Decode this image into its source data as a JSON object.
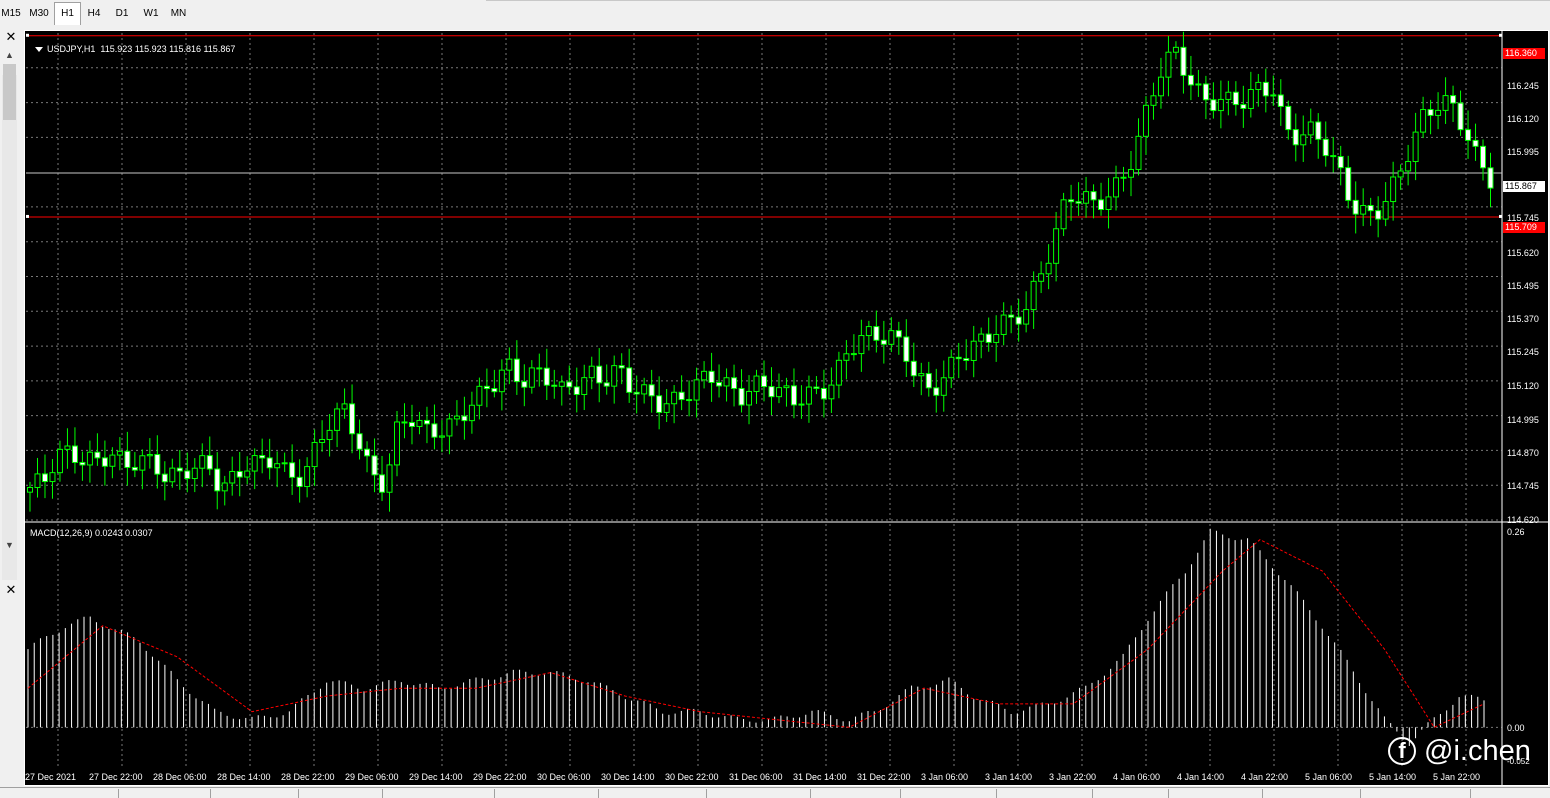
{
  "timeframes": [
    "M15",
    "M30",
    "H1",
    "H4",
    "D1",
    "W1",
    "MN"
  ],
  "active_timeframe": "H1",
  "chart": {
    "title": "USDJPY,H1  115.923 115.923 115.816 115.867",
    "macd_label": "MACD(12,26,9) 0.0243 0.0307",
    "price_ticks": [
      "116.245",
      "116.120",
      "115.995",
      "115.745",
      "115.620",
      "115.495",
      "115.370",
      "115.245",
      "115.120",
      "114.995",
      "114.870",
      "114.745",
      "114.620"
    ],
    "current_price": "115.867",
    "hline_top": "116.360",
    "hline_bottom": "115.709",
    "macd_ticks": [
      "0.26",
      "0.00",
      "-0.052"
    ],
    "time_labels": [
      "27 Dec 2021",
      "27 Dec 22:00",
      "28 Dec 06:00",
      "28 Dec 14:00",
      "28 Dec 22:00",
      "29 Dec 06:00",
      "29 Dec 14:00",
      "29 Dec 22:00",
      "30 Dec 06:00",
      "30 Dec 14:00",
      "30 Dec 22:00",
      "31 Dec 06:00",
      "31 Dec 14:00",
      "31 Dec 22:00",
      "3 Jan 06:00",
      "3 Jan 14:00",
      "3 Jan 22:00",
      "4 Jan 06:00",
      "4 Jan 14:00",
      "4 Jan 22:00",
      "5 Jan 06:00",
      "5 Jan 14:00",
      "5 Jan 22:00"
    ],
    "colors": {
      "background": "#000000",
      "bull": "#00ff00",
      "bear_body": "#ffffff",
      "grid": "#c8c8c8",
      "hline": "#ff0000",
      "signal": "#ff0000"
    }
  },
  "watermark": "@i.chen",
  "watermark_icon": "facebook-icon",
  "chart_data": [
    {
      "type": "candlestick",
      "symbol": "USDJPY",
      "timeframe": "H1",
      "ylim": [
        114.62,
        116.37
      ],
      "close_path": [
        114.72,
        114.74,
        114.86,
        114.88,
        114.85,
        114.82,
        114.84,
        114.8,
        114.86,
        114.84,
        114.78,
        114.76,
        114.8,
        114.82,
        114.76,
        114.78,
        114.82,
        114.8,
        114.84,
        114.78,
        114.8,
        114.88,
        114.96,
        115.0,
        114.92,
        114.8,
        114.76,
        114.95,
        114.97,
        114.93,
        114.96,
        114.98,
        115.02,
        115.05,
        115.1,
        115.18,
        115.14,
        115.16,
        115.12,
        115.06,
        115.1,
        115.16,
        115.14,
        115.16,
        115.08,
        115.06,
        115.05,
        115.06,
        115.08,
        115.1,
        115.12,
        115.1,
        115.08,
        115.12,
        115.1,
        115.06,
        115.04,
        115.08,
        115.1,
        115.14,
        115.22,
        115.26,
        115.28,
        115.3,
        115.26,
        115.12,
        115.06,
        115.12,
        115.22,
        115.26,
        115.28,
        115.3,
        115.32,
        115.38,
        115.52,
        115.64,
        115.78,
        115.76,
        115.74,
        115.8,
        115.86,
        115.96,
        116.1,
        116.24,
        116.3,
        116.22,
        116.14,
        116.12,
        116.1,
        116.12,
        116.18,
        116.2,
        116.02,
        115.98,
        116.0,
        115.96,
        115.88,
        115.76,
        115.7,
        115.72,
        115.82,
        115.96,
        116.08,
        116.12,
        116.1,
        116.02,
        115.92,
        115.867
      ]
    },
    {
      "type": "histogram+line",
      "name": "MACD(12,26,9)",
      "ylim": [
        -0.052,
        0.26
      ],
      "macd_points": [
        [
          0,
          0.1
        ],
        [
          6,
          0.13
        ],
        [
          10,
          0.14
        ],
        [
          18,
          0.11
        ],
        [
          24,
          0.06
        ],
        [
          30,
          0.02
        ],
        [
          36,
          0.01
        ],
        [
          42,
          0.02
        ],
        [
          48,
          0.06
        ],
        [
          54,
          0.05
        ],
        [
          60,
          0.06
        ],
        [
          66,
          0.05
        ],
        [
          72,
          0.06
        ],
        [
          78,
          0.07
        ],
        [
          84,
          0.07
        ],
        [
          90,
          0.06
        ],
        [
          96,
          0.04
        ],
        [
          102,
          0.02
        ],
        [
          108,
          0.02
        ],
        [
          114,
          0.01
        ],
        [
          120,
          0.01
        ],
        [
          126,
          0.02
        ],
        [
          132,
          0.01
        ],
        [
          136,
          0.02
        ],
        [
          142,
          0.05
        ],
        [
          148,
          0.06
        ],
        [
          152,
          0.04
        ],
        [
          158,
          0.02
        ],
        [
          164,
          0.03
        ],
        [
          170,
          0.05
        ],
        [
          176,
          0.09
        ],
        [
          180,
          0.14
        ],
        [
          186,
          0.2
        ],
        [
          190,
          0.25
        ],
        [
          196,
          0.24
        ],
        [
          202,
          0.19
        ],
        [
          208,
          0.13
        ],
        [
          214,
          0.06
        ],
        [
          218,
          0.01
        ],
        [
          222,
          -0.02
        ],
        [
          226,
          0.01
        ],
        [
          230,
          0.04
        ],
        [
          234,
          0.035
        ]
      ],
      "signal_points": [
        [
          0,
          0.05
        ],
        [
          12,
          0.13
        ],
        [
          24,
          0.09
        ],
        [
          36,
          0.02
        ],
        [
          48,
          0.04
        ],
        [
          60,
          0.05
        ],
        [
          72,
          0.05
        ],
        [
          84,
          0.07
        ],
        [
          96,
          0.04
        ],
        [
          108,
          0.02
        ],
        [
          120,
          0.01
        ],
        [
          132,
          0.0
        ],
        [
          144,
          0.05
        ],
        [
          156,
          0.03
        ],
        [
          168,
          0.03
        ],
        [
          180,
          0.1
        ],
        [
          192,
          0.2
        ],
        [
          198,
          0.24
        ],
        [
          208,
          0.2
        ],
        [
          218,
          0.1
        ],
        [
          226,
          0.0
        ],
        [
          234,
          0.03
        ]
      ],
      "signal_color": "#ff0000"
    }
  ]
}
